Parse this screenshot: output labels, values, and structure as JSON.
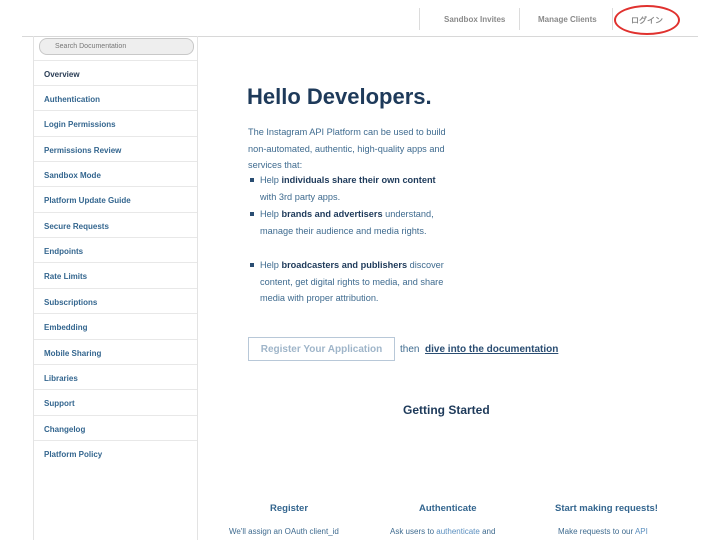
{
  "topnav": {
    "sandbox_invites": "Sandbox Invites",
    "manage_clients": "Manage Clients",
    "login": "ログイン"
  },
  "sidebar": {
    "search_placeholder": "Search Documentation",
    "items": [
      {
        "label": "Overview"
      },
      {
        "label": "Authentication"
      },
      {
        "label": "Login Permissions"
      },
      {
        "label": "Permissions Review"
      },
      {
        "label": "Sandbox Mode"
      },
      {
        "label": "Platform Update Guide"
      },
      {
        "label": "Secure Requests"
      },
      {
        "label": "Endpoints"
      },
      {
        "label": "Rate Limits"
      },
      {
        "label": "Subscriptions"
      },
      {
        "label": "Embedding"
      },
      {
        "label": "Mobile Sharing"
      },
      {
        "label": "Libraries"
      },
      {
        "label": "Support"
      },
      {
        "label": "Changelog"
      },
      {
        "label": "Platform Policy"
      }
    ]
  },
  "main": {
    "title": "Hello Developers.",
    "intro": "The Instagram API Platform can be used to build non-automated, authentic, high-quality apps and services that:",
    "bullets": [
      {
        "pre": "Help ",
        "bold": "individuals share their own content",
        "post": " with 3rd party apps."
      },
      {
        "pre": "Help ",
        "bold": "brands and advertisers",
        "post": " understand, manage their audience and media rights."
      },
      {
        "pre": "Help ",
        "bold": "broadcasters and publishers",
        "post": " discover content, get digital rights to media, and share media with proper attribution."
      }
    ],
    "register_button": "Register Your Application",
    "then": "then",
    "dive_link": "dive into the documentation",
    "getting_started": "Getting Started",
    "columns": [
      {
        "title": "Register",
        "text_pre": "We'll assign an OAuth client_id",
        "link": "",
        "text_post": ""
      },
      {
        "title": "Authenticate",
        "text_pre": "Ask users to ",
        "link": "authenticate",
        "text_post": " and"
      },
      {
        "title": "Start making requests!",
        "text_pre": "Make requests to our ",
        "link": "API",
        "text_post": ""
      }
    ]
  },
  "colors": {
    "accent": "#34668f",
    "heading": "#1e3a5a",
    "highlight_ring": "#e0312e"
  }
}
